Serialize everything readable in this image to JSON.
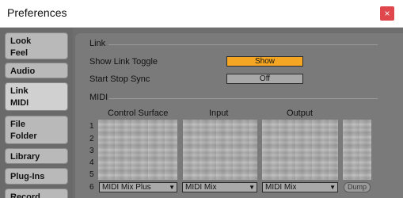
{
  "window": {
    "title": "Preferences",
    "close_label": "×"
  },
  "sidebar": {
    "tabs": [
      {
        "lines": [
          "Look",
          "Feel"
        ]
      },
      {
        "lines": [
          "Audio"
        ]
      },
      {
        "lines": [
          "Link",
          "MIDI"
        ]
      },
      {
        "lines": [
          "File",
          "Folder"
        ]
      },
      {
        "lines": [
          "Library"
        ]
      },
      {
        "lines": [
          "Plug-Ins"
        ]
      },
      {
        "lines": [
          "Record"
        ]
      }
    ]
  },
  "link": {
    "section_title": "Link",
    "show_link_toggle": {
      "label": "Show Link Toggle",
      "value": "Show"
    },
    "start_stop_sync": {
      "label": "Start Stop Sync",
      "value": "Off"
    }
  },
  "midi": {
    "section_title": "MIDI",
    "columns": {
      "control_surface": "Control Surface",
      "input": "Input",
      "output": "Output"
    },
    "row_numbers": [
      "1",
      "2",
      "3",
      "4",
      "5",
      "6"
    ],
    "row6": {
      "control_surface": "MIDI Mix Plus",
      "input": "MIDI Mix",
      "output": "MIDI Mix",
      "dump": "Dump"
    }
  },
  "colors": {
    "accent": "#f5a623",
    "close": "#e0474c"
  }
}
